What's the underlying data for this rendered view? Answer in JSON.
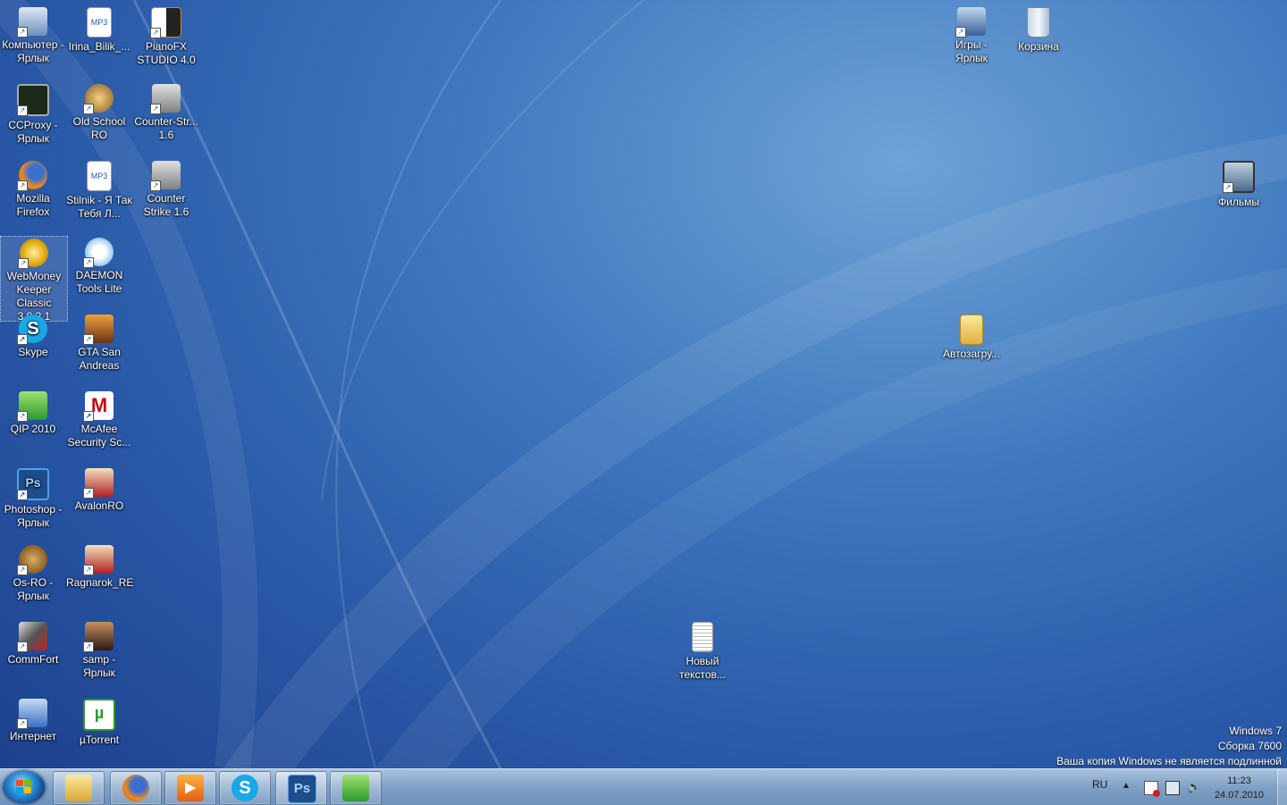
{
  "desktop": {
    "icons": [
      {
        "label": "Компьютер - Ярлык"
      },
      {
        "label": "Irina_Bilik_..."
      },
      {
        "label": "PianoFX STUDIO 4.0"
      },
      {
        "label": "CCProxy - Ярлык"
      },
      {
        "label": "Old School RO"
      },
      {
        "label": "Counter-Str... 1.6"
      },
      {
        "label": "Mozilla Firefox"
      },
      {
        "label": "Stilnik - Я Так Тебя Л..."
      },
      {
        "label": "Counter Strike 1.6"
      },
      {
        "label": "WebMoney Keeper Classic 3.9.2.1"
      },
      {
        "label": "DAEMON Tools Lite"
      },
      {
        "label": "Skype"
      },
      {
        "label": "GTA San Andreas"
      },
      {
        "label": "QIP 2010"
      },
      {
        "label": "McAfee Security Sc..."
      },
      {
        "label": "Photoshop - Ярлык"
      },
      {
        "label": "AvalonRO"
      },
      {
        "label": "Os-RO - Ярлык"
      },
      {
        "label": "Ragnarok_RE"
      },
      {
        "label": "CommFort"
      },
      {
        "label": "samp - Ярлык"
      },
      {
        "label": "Интернет"
      },
      {
        "label": "µTorrent"
      },
      {
        "label": "Игры - Ярлык"
      },
      {
        "label": "Корзина"
      },
      {
        "label": "Фильмы"
      },
      {
        "label": "Автозагру..."
      },
      {
        "label": "Новый текстов..."
      }
    ]
  },
  "watermark": {
    "line1": "Windows 7",
    "line2": "Сборка 7600",
    "line3": "Ваша копия Windows не является подлинной"
  },
  "taskbar": {
    "pinned": [
      {
        "icon": "explorer-icon"
      },
      {
        "icon": "firefox-icon"
      },
      {
        "icon": "media-player-icon"
      },
      {
        "icon": "skype-icon"
      },
      {
        "icon": "photoshop-icon",
        "text": "Ps"
      },
      {
        "icon": "qip-icon"
      }
    ],
    "language": "RU",
    "time": "11:23",
    "date": "24.07.2010"
  }
}
